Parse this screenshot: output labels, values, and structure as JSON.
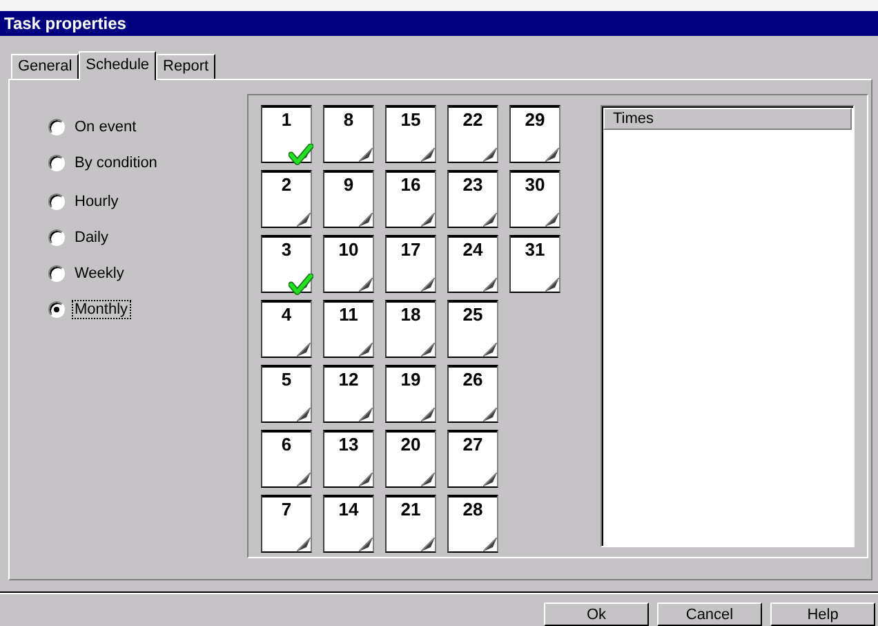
{
  "window": {
    "title": "Task properties"
  },
  "tabs": [
    {
      "label": "General",
      "selected": false
    },
    {
      "label": "Schedule",
      "selected": true
    },
    {
      "label": "Report",
      "selected": false
    }
  ],
  "radio_groups": [
    {
      "options": [
        {
          "label": "On event",
          "selected": false,
          "focused": false
        },
        {
          "label": "By condition",
          "selected": false,
          "focused": false
        }
      ]
    },
    {
      "options": [
        {
          "label": "Hourly",
          "selected": false,
          "focused": false
        },
        {
          "label": "Daily",
          "selected": false,
          "focused": false
        },
        {
          "label": "Weekly",
          "selected": false,
          "focused": false
        },
        {
          "label": "Monthly",
          "selected": true,
          "focused": true
        }
      ]
    }
  ],
  "days": [
    {
      "label": "1",
      "checked": true
    },
    {
      "label": "2",
      "checked": false
    },
    {
      "label": "3",
      "checked": true
    },
    {
      "label": "4",
      "checked": false
    },
    {
      "label": "5",
      "checked": false
    },
    {
      "label": "6",
      "checked": false
    },
    {
      "label": "7",
      "checked": false
    },
    {
      "label": "8",
      "checked": false
    },
    {
      "label": "9",
      "checked": false
    },
    {
      "label": "10",
      "checked": false
    },
    {
      "label": "11",
      "checked": false
    },
    {
      "label": "12",
      "checked": false
    },
    {
      "label": "13",
      "checked": false
    },
    {
      "label": "14",
      "checked": false
    },
    {
      "label": "15",
      "checked": false
    },
    {
      "label": "16",
      "checked": false
    },
    {
      "label": "17",
      "checked": false
    },
    {
      "label": "18",
      "checked": false
    },
    {
      "label": "19",
      "checked": false
    },
    {
      "label": "20",
      "checked": false
    },
    {
      "label": "21",
      "checked": false
    },
    {
      "label": "22",
      "checked": false
    },
    {
      "label": "23",
      "checked": false
    },
    {
      "label": "24",
      "checked": false
    },
    {
      "label": "25",
      "checked": false
    },
    {
      "label": "26",
      "checked": false
    },
    {
      "label": "27",
      "checked": false
    },
    {
      "label": "28",
      "checked": false
    },
    {
      "label": "29",
      "checked": false
    },
    {
      "label": "30",
      "checked": false
    },
    {
      "label": "31",
      "checked": false
    }
  ],
  "times_list": {
    "header": "Times"
  },
  "buttons": [
    "Ok",
    "Cancel",
    "Help"
  ]
}
